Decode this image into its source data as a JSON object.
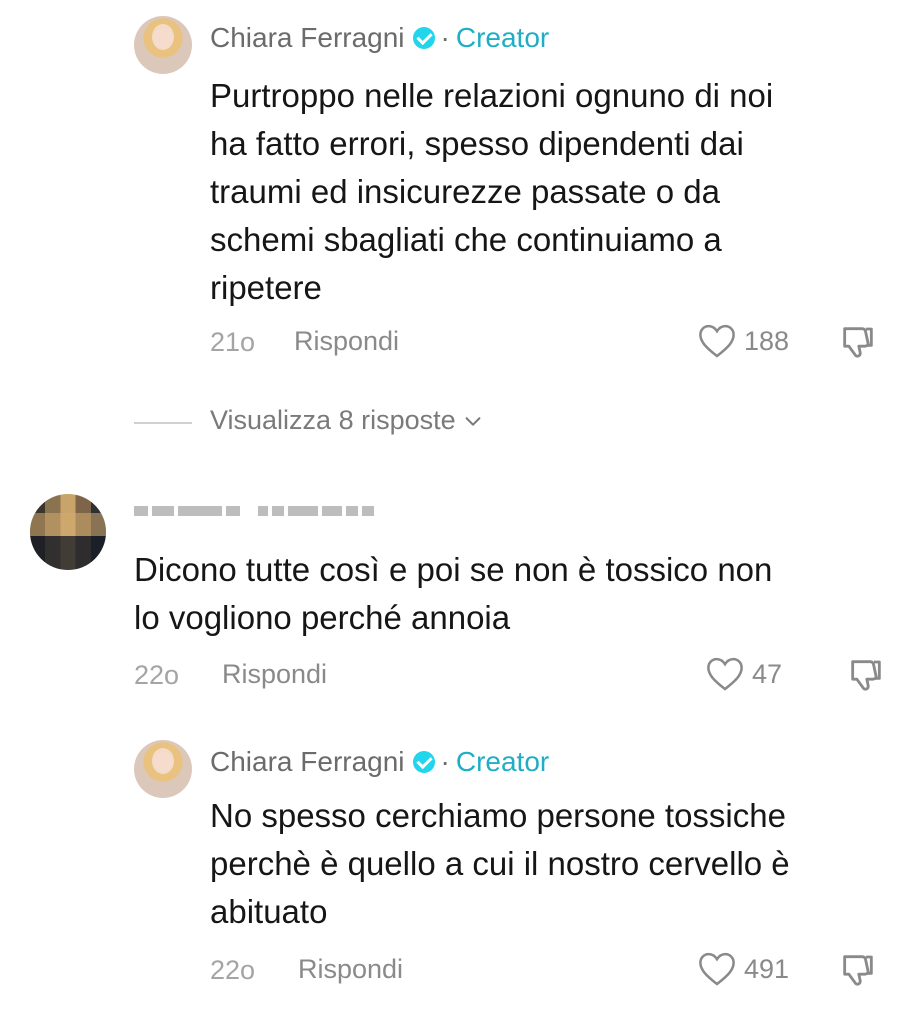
{
  "comments": [
    {
      "author": "Chiara Ferragni",
      "separator": "·",
      "badge": "Creator",
      "text_lines": [
        "Purtroppo nelle relazioni ognuno di noi",
        "ha fatto errori, spesso dipendenti dai",
        "traumi ed insicurezze passate o da",
        "schemi sbagliati che continuiamo a",
        "ripetere"
      ],
      "time": "21o",
      "reply_label": "Rispondi",
      "likes": "188"
    },
    {
      "author": "",
      "text_lines": [
        "Dicono tutte così e poi se non è tossico non",
        "lo vogliono perché annoia"
      ],
      "time": "22o",
      "reply_label": "Rispondi",
      "likes": "47"
    },
    {
      "author": "Chiara Ferragni",
      "separator": "·",
      "badge": "Creator",
      "text_lines": [
        "No spesso cerchiamo persone tossiche",
        "perchè è quello a cui il nostro cervello è",
        "abituato"
      ],
      "time": "22o",
      "reply_label": "Rispondi",
      "likes": "491"
    }
  ],
  "view_replies": {
    "label": "Visualizza 8 risposte"
  },
  "icons": {
    "verified": "verified-badge-icon",
    "like": "heart-outline-icon",
    "dislike": "thumbs-down-icon",
    "chevron": "chevron-down-icon"
  },
  "colors": {
    "creator": "#20aec4",
    "verified": "#20d5ec",
    "text": "#161616",
    "muted": "#8a8a8a"
  }
}
